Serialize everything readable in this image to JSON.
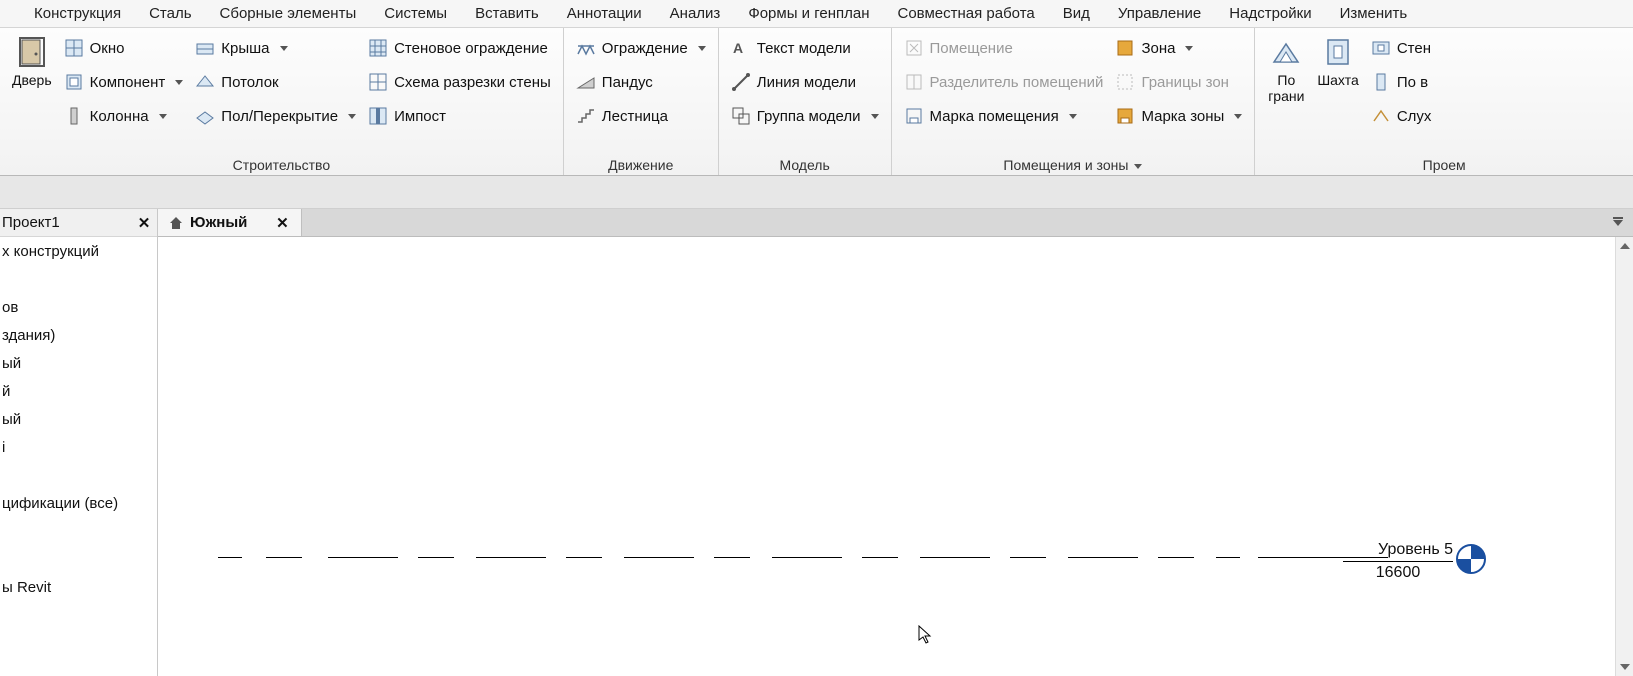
{
  "tabs": [
    "Конструкция",
    "Сталь",
    "Сборные элементы",
    "Системы",
    "Вставить",
    "Аннотации",
    "Анализ",
    "Формы и генплан",
    "Совместная работа",
    "Вид",
    "Управление",
    "Надстройки",
    "Изменить"
  ],
  "ribbon": {
    "panel1": {
      "door": "Дверь",
      "window": "Окно",
      "component": "Компонент",
      "column": "Колонна",
      "roof": "Крыша",
      "ceiling": "Потолок",
      "floor": "Пол/Перекрытие",
      "curtainwall": "Стеновое ограждение",
      "scheme": "Схема разрезки стены",
      "imposed": "Импост",
      "title": "Строительство"
    },
    "panel2": {
      "fence": "Ограждение",
      "ramp": "Пандус",
      "stair": "Лестница",
      "title": "Движение"
    },
    "panel3": {
      "modeltext": "Текст модели",
      "modelline": "Линия  модели",
      "modelgroup": "Группа модели",
      "title": "Модель"
    },
    "panel4": {
      "room": "Помещение",
      "roomsep": "Разделитель помещений",
      "roomtag": "Марка помещения",
      "zone": "Зона",
      "zonebound": "Границы  зон",
      "zonetag": "Марка  зоны",
      "title": "Помещения и зоны"
    },
    "panel5": {
      "byface": "По",
      "byface2": "грани",
      "shaft": "Шахта",
      "wall": "Стен",
      "vert": "По в",
      "ceil": "Слух",
      "title": "Проем"
    }
  },
  "project_panel": {
    "title": "Проект1",
    "items": [
      "х конструкций",
      "",
      "ов",
      " здания)",
      "ый",
      "й",
      "ый",
      "і",
      "",
      "цификации (все)",
      "",
      "",
      "ы Revit"
    ]
  },
  "view": {
    "tab": "Южный"
  },
  "level": {
    "name": "Уровень 5",
    "value": "16600"
  }
}
